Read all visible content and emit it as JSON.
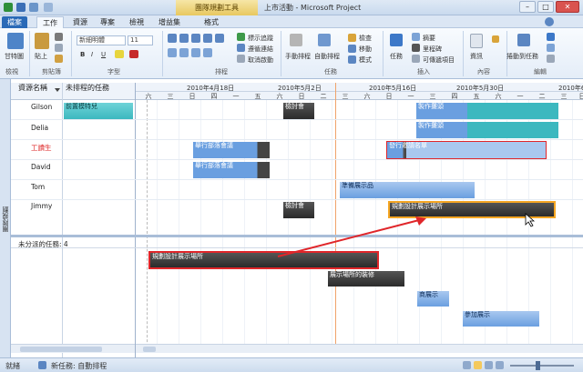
{
  "window": {
    "title": "上市活動 - Microsoft Project",
    "context_tab_group": "團隊規劃工具"
  },
  "tabs": [
    "檔案",
    "工作",
    "資源",
    "專案",
    "檢視",
    "增益集",
    "格式"
  ],
  "ribbon": {
    "gantt_label": "甘特圖",
    "paste_label": "貼上",
    "font_name": "新細明體",
    "font_size": "11",
    "mark_on_track": "標示追蹤",
    "respect_links": "遵循連結",
    "inactivate": "取消啟動",
    "manual_schedule": "手動排程",
    "auto_schedule": "自動排程",
    "inspect": "檢查",
    "move": "移動",
    "mode": "模式",
    "task": "任務",
    "summary": "摘要",
    "milestone": "里程碑",
    "deliverable": "可傳遞項目",
    "information": "資訊",
    "scroll_to_task": "捲動到任務",
    "groups": [
      "檢視",
      "剪貼簿",
      "字型",
      "排程",
      "任務",
      "插入",
      "內容",
      "編輯"
    ]
  },
  "left_label": "團隊規劃",
  "grid": {
    "col_resource": "資源名稱",
    "col_unscheduled": "未排程的任務",
    "dates": [
      "2010年4月18日",
      "2010年5月2日",
      "2010年5月16日",
      "2010年5月30日",
      "2010年6"
    ],
    "days": [
      "六",
      "日",
      "一",
      "二",
      "三",
      "四",
      "五",
      "六",
      "日",
      "一",
      "二",
      "三",
      "四",
      "五",
      "六",
      "日",
      "一",
      "二",
      "三",
      "四",
      "五",
      "六",
      "日",
      "一",
      "二",
      "三",
      "日"
    ],
    "resources": [
      "Gilson",
      "Delia",
      "工讀生",
      "David",
      "Tom",
      "Jimmy"
    ],
    "unscheduled_header": "未分派的任務: 4"
  },
  "tasks": {
    "gilson_unsched": "前置模特兒",
    "gilson_bar1": "檢討會",
    "gilson_bar2": "製作攤頭",
    "delia_bar": "製作攤頭",
    "worker_bar1": "舉行部落會議",
    "worker_bar2": "發行邀請名單",
    "david_bar": "舉行部落會議",
    "tom_bar": "準備展示品",
    "jimmy_bar1": "檢討會",
    "jimmy_bar2": "規劃設計展示場所",
    "un_bar1": "規劃設計展示場所",
    "un_bar2": "展示場所的裝修",
    "un_bar3": "商展示",
    "un_bar4": "參加展示"
  },
  "status": {
    "ready": "就緒",
    "new_task_mode": "新任務: 自動排程"
  },
  "colors": {
    "accent": "#2a6ab7",
    "highlight_red": "#e0262a",
    "selection_orange": "#f5a623",
    "teal_bar": "#3cb8bf",
    "blue_bar": "#6a9fe0",
    "dark_bar": "#2b2b2b"
  }
}
